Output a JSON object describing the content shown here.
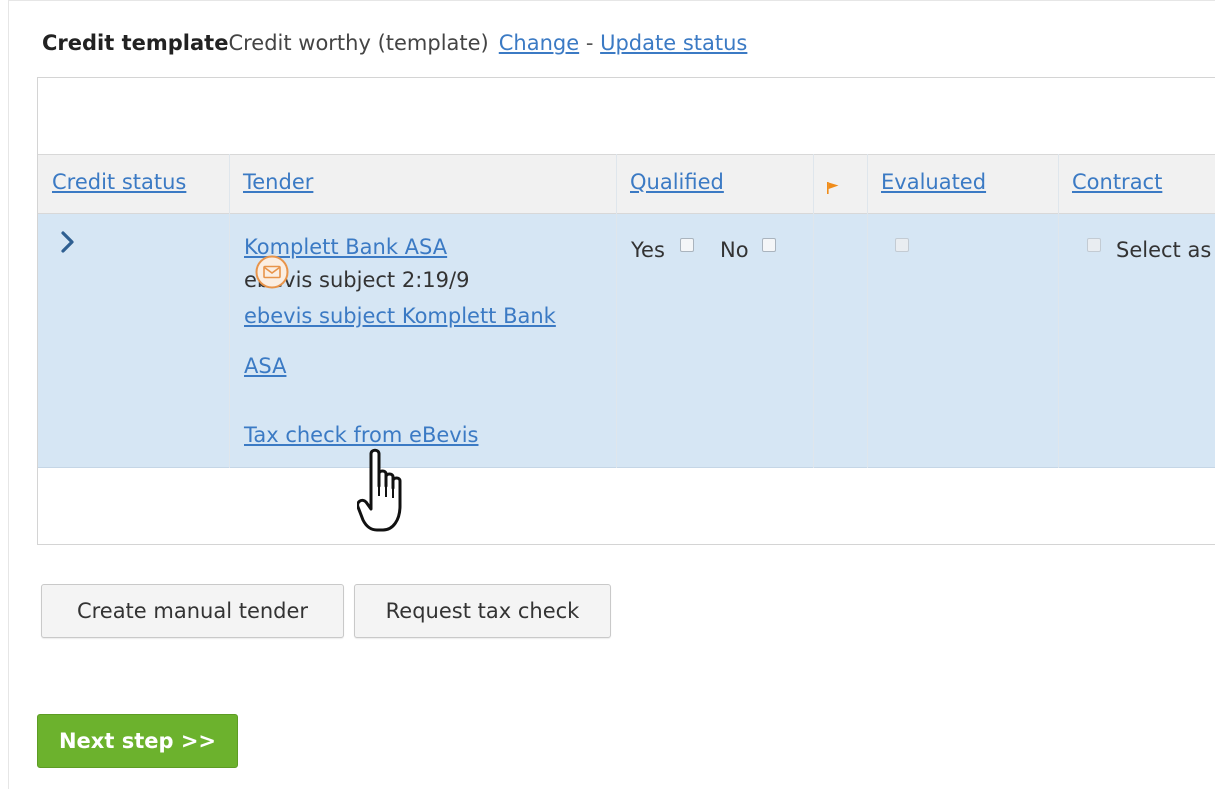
{
  "header": {
    "label_bold": "Credit template",
    "label_value": "Credit worthy (template)",
    "change_link": "Change",
    "separator": " - ",
    "update_link": "Update status"
  },
  "table": {
    "columns": {
      "credit_status": "Credit status",
      "tender": "Tender",
      "qualified": "Qualified",
      "evaluated": "Evaluated",
      "contract": "Contract"
    },
    "rows": [
      {
        "tender_name": "Komplett Bank ASA",
        "subject": "ebevis subject 2:19/9",
        "subject_link_line1": "ebevis subject Komplett Bank",
        "subject_link_line2": "ASA",
        "tax_check_link": "Tax check from eBevis",
        "qualified_yes": "Yes",
        "qualified_no": "No",
        "contract_text": "Select as"
      }
    ]
  },
  "buttons": {
    "create_manual_tender": "Create manual tender",
    "request_tax_check": "Request tax check",
    "next_step": "Next step >>"
  },
  "colors": {
    "link": "#3b7ac4",
    "row_highlight": "#d6e6f4",
    "next_button": "#6cb22d",
    "flag": "#f08c1a",
    "mail_icon": "#e8944a"
  },
  "icons": [
    "chevron-right-icon",
    "flag-icon",
    "mail-icon",
    "hand-cursor-icon"
  ]
}
